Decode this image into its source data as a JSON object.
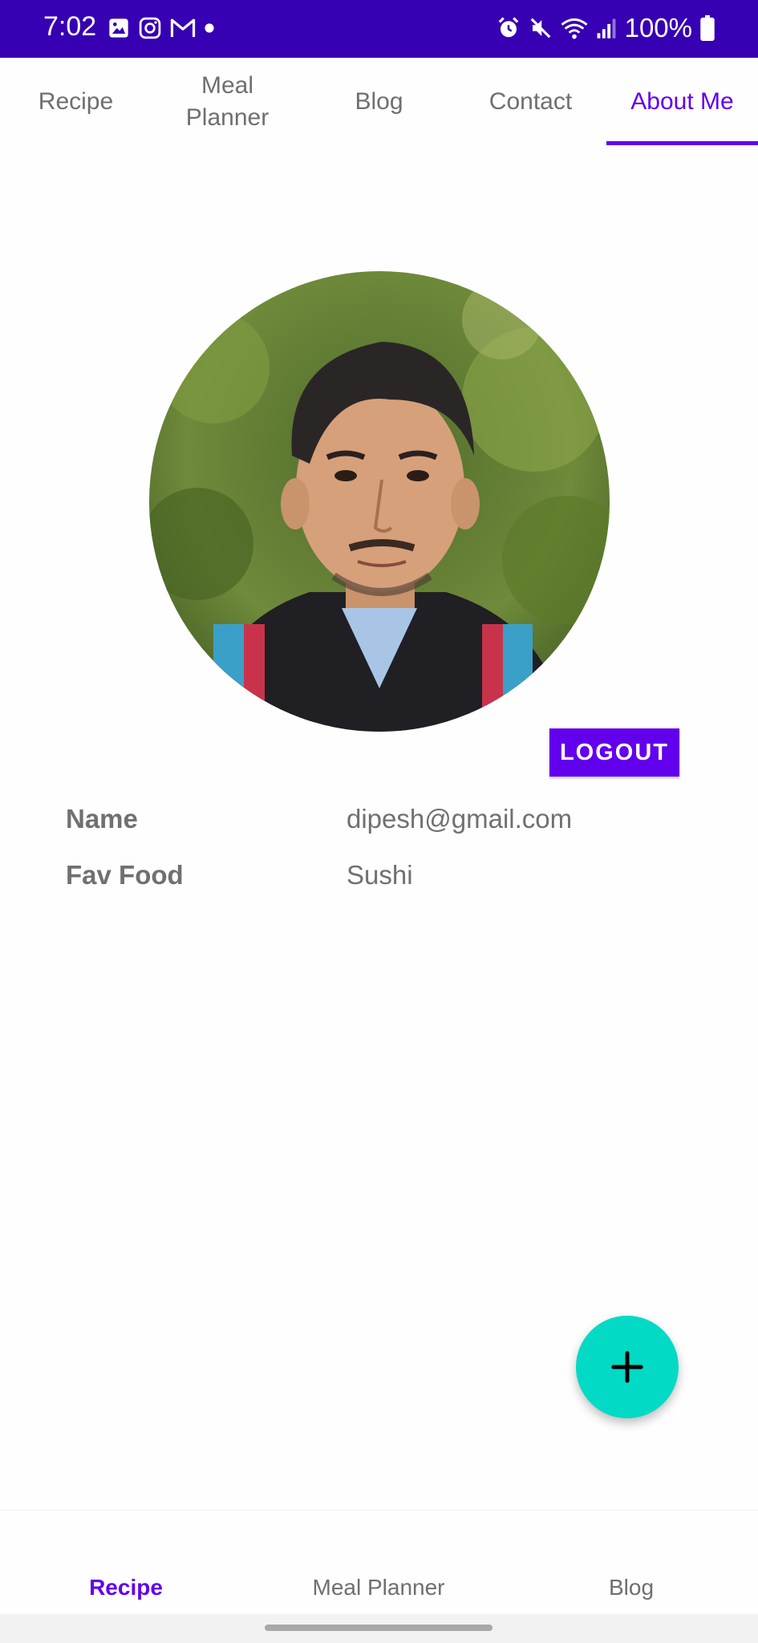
{
  "status_bar": {
    "time": "7:02",
    "battery": "100%",
    "icons_left": [
      "gallery-icon",
      "instagram-icon",
      "gmail-icon",
      "dot-icon"
    ],
    "icons_right": [
      "alarm-icon",
      "mute-icon",
      "wifi-icon",
      "signal-icon",
      "battery-icon"
    ]
  },
  "tabs": [
    {
      "line1": "Recipe",
      "line2": ""
    },
    {
      "line1": "Meal",
      "line2": "Planner"
    },
    {
      "line1": "Blog",
      "line2": ""
    },
    {
      "line1": "Contact",
      "line2": ""
    },
    {
      "line1": "About Me",
      "line2": ""
    }
  ],
  "active_tab": "About Me",
  "profile": {
    "logout_label": "LOGOUT",
    "name_label": "Name",
    "name_value": "dipesh@gmail.com",
    "food_label": "Fav Food",
    "food_value": "Sushi"
  },
  "fab_icon": "plus-icon",
  "bottom_nav": [
    {
      "label": "Recipe",
      "active": true
    },
    {
      "label": "Meal Planner",
      "active": false
    },
    {
      "label": "Blog",
      "active": false
    }
  ],
  "colors": {
    "status_bar": "#3700b3",
    "primary": "#6200ee",
    "fab": "#03dac5",
    "text_gray": "#707070"
  }
}
